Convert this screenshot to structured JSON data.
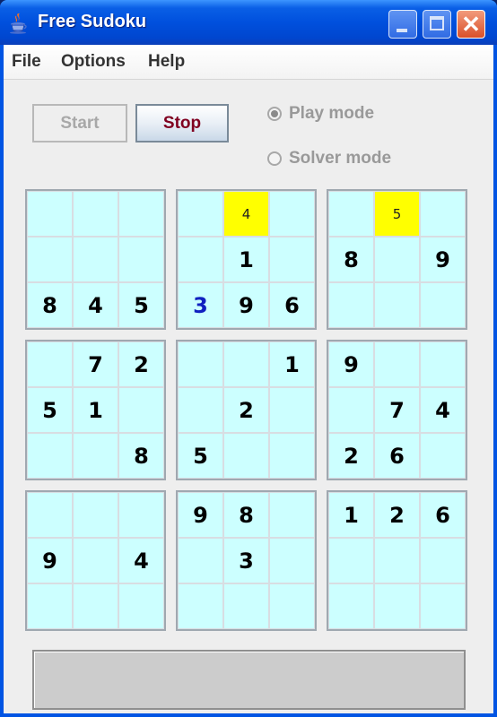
{
  "window": {
    "title": "Free Sudoku",
    "icon": "java-coffee-cup-icon",
    "controls": {
      "minimize": "minimize-icon",
      "maximize": "maximize-icon",
      "close_glyph": "✕"
    }
  },
  "menu": [
    "File",
    "Options",
    "Help"
  ],
  "toolbar": {
    "start_label": "Start",
    "start_enabled": false,
    "stop_label": "Stop",
    "stop_enabled": true
  },
  "modes": [
    {
      "label": "Play mode",
      "selected": true,
      "enabled": false
    },
    {
      "label": "Solver mode",
      "selected": false,
      "enabled": false
    }
  ],
  "colors": {
    "cell_background": "#ccffff",
    "hint_background": "#ffff00",
    "given_digit": "#000000",
    "user_digit": "#1020c0",
    "stop_text": "#800020"
  },
  "board": {
    "rows": [
      [
        null,
        null,
        null,
        null,
        {
          "v": "4",
          "type": "hint"
        },
        null,
        null,
        {
          "v": "5",
          "type": "hint"
        },
        null
      ],
      [
        null,
        null,
        null,
        null,
        {
          "v": "1"
        },
        null,
        {
          "v": "8"
        },
        null,
        {
          "v": "9"
        }
      ],
      [
        {
          "v": "8"
        },
        {
          "v": "4"
        },
        {
          "v": "5"
        },
        {
          "v": "3",
          "type": "user"
        },
        {
          "v": "9"
        },
        {
          "v": "6"
        },
        null,
        null,
        null
      ],
      [
        null,
        {
          "v": "7"
        },
        {
          "v": "2"
        },
        null,
        null,
        {
          "v": "1"
        },
        {
          "v": "9"
        },
        null,
        null
      ],
      [
        {
          "v": "5"
        },
        {
          "v": "1"
        },
        null,
        null,
        {
          "v": "2"
        },
        null,
        null,
        {
          "v": "7"
        },
        {
          "v": "4"
        }
      ],
      [
        null,
        null,
        {
          "v": "8"
        },
        {
          "v": "5"
        },
        null,
        null,
        {
          "v": "2"
        },
        {
          "v": "6"
        },
        null
      ],
      [
        null,
        null,
        null,
        {
          "v": "9"
        },
        {
          "v": "8"
        },
        null,
        {
          "v": "1"
        },
        {
          "v": "2"
        },
        {
          "v": "6"
        }
      ],
      [
        {
          "v": "9"
        },
        null,
        {
          "v": "4"
        },
        null,
        {
          "v": "3"
        },
        null,
        null,
        null,
        null
      ],
      [
        null,
        null,
        null,
        null,
        null,
        null,
        null,
        null,
        null
      ]
    ]
  },
  "status_text": ""
}
